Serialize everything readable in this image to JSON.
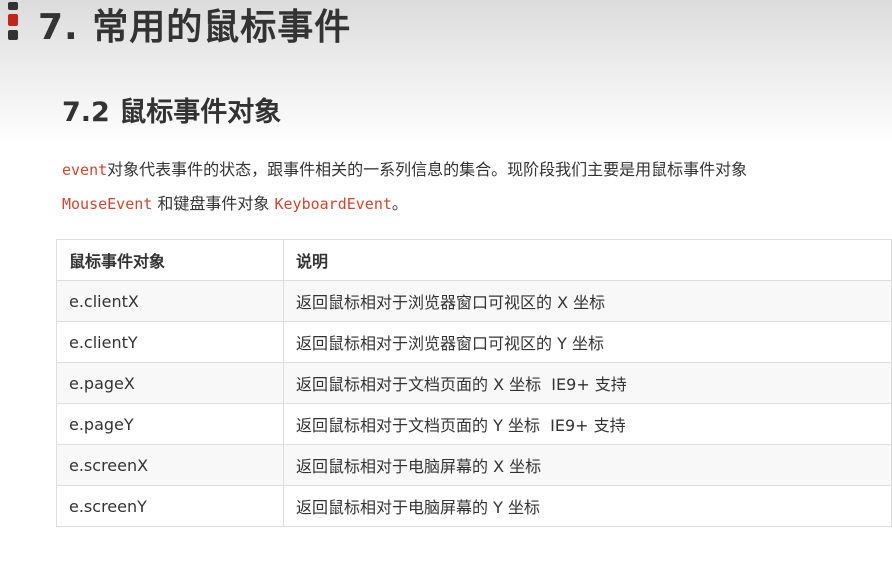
{
  "header": {
    "title": "7. 常用的鼠标事件"
  },
  "section": {
    "title": "7.2 鼠标事件对象"
  },
  "intro": {
    "code_event": "event",
    "text1": "对象代表事件的状态，跟事件相关的一系列信息的集合。现阶段我们主要是用鼠标事件对象",
    "code_mouse": "MouseEvent",
    "text2": " 和键盘事件对象 ",
    "code_keyboard": "KeyboardEvent",
    "text3": "。"
  },
  "table": {
    "headers": [
      "鼠标事件对象",
      "说明"
    ],
    "rows": [
      [
        "e.clientX",
        "返回鼠标相对于浏览器窗口可视区的 X 坐标"
      ],
      [
        "e.clientY",
        "返回鼠标相对于浏览器窗口可视区的 Y 坐标"
      ],
      [
        "e.pageX",
        "返回鼠标相对于文档页面的 X 坐标  IE9+ 支持"
      ],
      [
        "e.pageY",
        "返回鼠标相对于文档页面的 Y 坐标  IE9+ 支持"
      ],
      [
        "e.screenX",
        "返回鼠标相对于电脑屏幕的 X 坐标"
      ],
      [
        "e.screenY",
        "返回鼠标相对于电脑屏幕的 Y 坐标"
      ]
    ]
  },
  "colors": {
    "accent": "#c0261a",
    "code": "#d1462f",
    "text": "#333333"
  }
}
